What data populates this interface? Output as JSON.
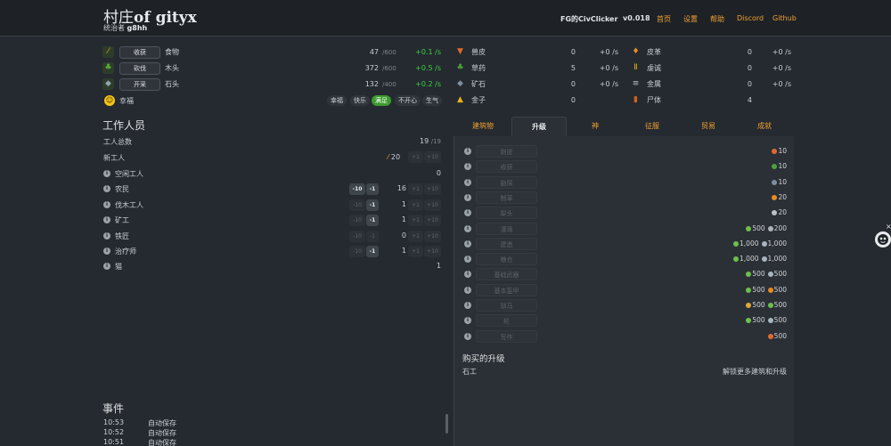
{
  "header": {
    "title_main": "村庄",
    "title_name": "of gityx",
    "ruler_prefix": "统治者",
    "ruler_name": "g8hh",
    "nav": [
      {
        "label": "FG的CivClicker",
        "kind": "ver"
      },
      {
        "label": "v0.018",
        "kind": "ver"
      },
      {
        "label": "首页",
        "kind": "link"
      },
      {
        "label": "设置",
        "kind": "link"
      },
      {
        "label": "帮助",
        "kind": "link"
      },
      {
        "label": "Discord",
        "kind": "link"
      },
      {
        "label": "Github",
        "kind": "link"
      }
    ]
  },
  "basic_resources": [
    {
      "icon": "wheat-icon",
      "button": "收获",
      "name": "食物",
      "amount": "47",
      "cap": "/600",
      "rate": "+0.1 /s"
    },
    {
      "icon": "tree-icon",
      "button": "砍伐",
      "name": "木头",
      "amount": "372",
      "cap": "/600",
      "rate": "+0.5 /s"
    },
    {
      "icon": "rock-icon",
      "button": "开采",
      "name": "石头",
      "amount": "132",
      "cap": "/400",
      "rate": "+0.2 /s"
    }
  ],
  "happiness": {
    "label": "幸福",
    "levels": [
      "幸福",
      "快乐",
      "满足",
      "不开心",
      "生气"
    ],
    "active": "满足"
  },
  "special_resources": {
    "col1": [
      {
        "icon": "hide-icon",
        "name": "兽皮",
        "amount": "0",
        "rate": "+0 /s"
      },
      {
        "icon": "herbs-icon",
        "name": "草药",
        "amount": "5",
        "rate": "+0 /s"
      },
      {
        "icon": "ore-icon",
        "name": "矿石",
        "amount": "0",
        "rate": "+0 /s"
      },
      {
        "icon": "gold-icon",
        "name": "金子",
        "amount": "0",
        "rate": ""
      }
    ],
    "col2": [
      {
        "icon": "leather-icon",
        "name": "皮革",
        "amount": "0",
        "rate": "+0 /s"
      },
      {
        "icon": "piety-icon",
        "name": "虔诚",
        "amount": "0",
        "rate": "+0 /s"
      },
      {
        "icon": "metal-icon",
        "name": "金属",
        "amount": "0",
        "rate": "+0 /s"
      },
      {
        "icon": "corpse-icon",
        "name": "尸体",
        "amount": "4",
        "rate": ""
      }
    ]
  },
  "workers": {
    "heading": "工作人员",
    "total_label": "工人总数",
    "total_value": "19",
    "total_cap": "/19",
    "new_label": "新工人",
    "new_cost": "20",
    "new_buttons": [
      "+1",
      "+10"
    ],
    "jobs": [
      {
        "name": "空闲工人",
        "count": "0",
        "buttons": false,
        "minus_active": false
      },
      {
        "name": "农民",
        "count": "16",
        "buttons": true,
        "minus_active": true,
        "minus10_active": true
      },
      {
        "name": "伐木工人",
        "count": "1",
        "buttons": true,
        "minus_active": true,
        "minus10_active": false
      },
      {
        "name": "矿工",
        "count": "1",
        "buttons": true,
        "minus_active": true,
        "minus10_active": false
      },
      {
        "name": "铁匠",
        "count": "0",
        "buttons": true,
        "minus_active": false,
        "minus10_active": false
      },
      {
        "name": "治疗师",
        "count": "1",
        "buttons": true,
        "minus_active": true,
        "minus10_active": false
      },
      {
        "name": "猫",
        "count": "1",
        "buttons": false,
        "minus_active": false
      }
    ],
    "minus10": "-10",
    "minus1": "-1",
    "plus1": "+1",
    "plus10": "+10"
  },
  "events": {
    "heading": "事件",
    "items": [
      {
        "time": "10:53",
        "text": "自动保存"
      },
      {
        "time": "10:52",
        "text": "自动保存"
      },
      {
        "time": "10:51",
        "text": "自动保存"
      }
    ]
  },
  "tabs": [
    "建筑物",
    "升级",
    "神",
    "征服",
    "贸易",
    "成就"
  ],
  "active_tab": "升级",
  "upgrades": [
    {
      "name": "剥皮",
      "costs": [
        {
          "icon": "hide-icon",
          "value": "10"
        }
      ]
    },
    {
      "name": "收获",
      "costs": [
        {
          "icon": "herbs-icon",
          "value": "10"
        }
      ]
    },
    {
      "name": "勘探",
      "costs": [
        {
          "icon": "ore-icon",
          "value": "10"
        }
      ]
    },
    {
      "name": "制革",
      "costs": [
        {
          "icon": "leather-icon",
          "value": "20"
        }
      ]
    },
    {
      "name": "犁头",
      "costs": [
        {
          "icon": "metal-icon",
          "value": "20"
        }
      ]
    },
    {
      "name": "灌溉",
      "costs": [
        {
          "icon": "wood-icon",
          "value": "500"
        },
        {
          "icon": "stone-icon",
          "value": "200"
        }
      ]
    },
    {
      "name": "建造",
      "costs": [
        {
          "icon": "wood-icon",
          "value": "1,000"
        },
        {
          "icon": "stone-icon",
          "value": "1,000"
        }
      ]
    },
    {
      "name": "粮仓",
      "costs": [
        {
          "icon": "wood-icon",
          "value": "1,000"
        },
        {
          "icon": "stone-icon",
          "value": "1,000"
        }
      ]
    },
    {
      "name": "基础武器",
      "costs": [
        {
          "icon": "wood-icon",
          "value": "500"
        },
        {
          "icon": "stone-icon",
          "value": "500"
        }
      ]
    },
    {
      "name": "基本盔甲",
      "costs": [
        {
          "icon": "wood-icon",
          "value": "500"
        },
        {
          "icon": "leather-icon",
          "value": "500"
        }
      ]
    },
    {
      "name": "驯马",
      "costs": [
        {
          "icon": "food-icon",
          "value": "500"
        },
        {
          "icon": "wood-icon",
          "value": "500"
        }
      ]
    },
    {
      "name": "轮",
      "costs": [
        {
          "icon": "wood-icon",
          "value": "500"
        },
        {
          "icon": "stone-icon",
          "value": "500"
        }
      ]
    },
    {
      "name": "写作",
      "costs": [
        {
          "icon": "hide-icon",
          "value": "500"
        }
      ]
    }
  ],
  "purchased": {
    "heading": "购买的升级",
    "item": "石工",
    "note": "解锁更多建筑和升级"
  },
  "colors": {
    "accent": "#f0a030",
    "rate_positive": "#3cd23c",
    "background": "#252a30",
    "active_happiness": "#3a9a2e"
  }
}
